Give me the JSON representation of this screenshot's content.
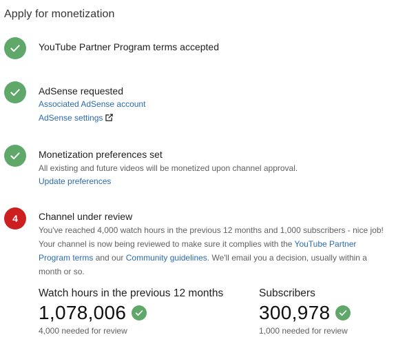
{
  "page": {
    "title": "Apply for monetization"
  },
  "steps": [
    {
      "status": "done",
      "icon": "check-icon",
      "title": "YouTube Partner Program terms accepted"
    },
    {
      "status": "done",
      "icon": "check-icon",
      "title": "AdSense requested",
      "links": {
        "associated_account": "Associated AdSense account",
        "settings": "AdSense settings"
      }
    },
    {
      "status": "done",
      "icon": "check-icon",
      "title": "Monetization preferences set",
      "description": "All existing and future videos will be monetized upon channel approval.",
      "links": {
        "update": "Update preferences"
      }
    },
    {
      "status": "in-progress",
      "number": "4",
      "title": "Channel under review",
      "description_part1": "You've reached 4,000 watch hours in the previous 12 months and 1,000 subscribers - nice job! Your channel is now being reviewed to make sure it complies with the ",
      "link_terms": "YouTube Partner Program terms",
      "description_part2": " and our ",
      "link_guidelines": "Community guidelines",
      "description_part3": ". We'll email you a decision, usually within a month or so."
    }
  ],
  "stats": {
    "watch_hours": {
      "label": "Watch hours in the previous 12 months",
      "value": "1,078,006",
      "requirement": "4,000 needed for review"
    },
    "subscribers": {
      "label": "Subscribers",
      "value": "300,978",
      "requirement": "1,000 needed for review"
    }
  },
  "colors": {
    "check_green": "#5fa86a",
    "step_red": "#cc1f1f",
    "link_blue": "#2a6bb0",
    "secondary_text": "#606060"
  }
}
